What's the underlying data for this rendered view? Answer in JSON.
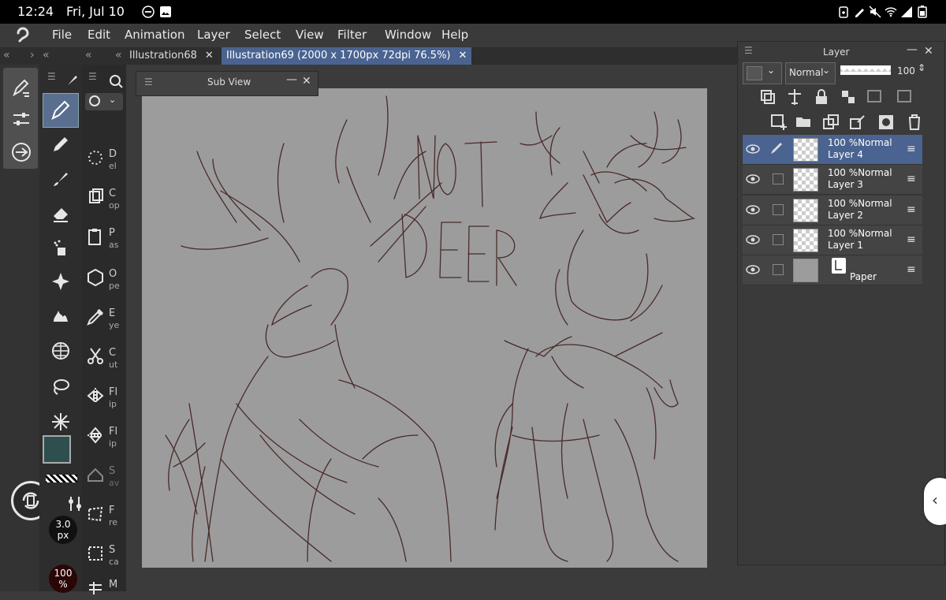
{
  "status_bar": {
    "time": "12:24",
    "date": "Fri, Jul 10"
  },
  "menu": [
    "File",
    "Edit",
    "Animation",
    "Layer",
    "Select",
    "View",
    "Filter",
    "Window",
    "Help"
  ],
  "tabs": [
    {
      "label": "Illustration68",
      "active": false
    },
    {
      "label": "Illustration69 (2000 x 1700px 72dpi 76.5%)",
      "active": true
    }
  ],
  "subview": {
    "title": "Sub View"
  },
  "subtools": [
    {
      "t1": "D",
      "t2": "el"
    },
    {
      "t1": "C",
      "t2": "op"
    },
    {
      "t1": "P",
      "t2": "as"
    },
    {
      "t1": "O",
      "t2": "pe"
    },
    {
      "t1": "E",
      "t2": "ye"
    },
    {
      "t1": "C",
      "t2": "ut"
    },
    {
      "t1": "Fl",
      "t2": "ip"
    },
    {
      "t1": "Fl",
      "t2": "ip"
    },
    {
      "t1": "S",
      "t2": "av"
    },
    {
      "t1": "F",
      "t2": "re"
    },
    {
      "t1": "S",
      "t2": "ca"
    },
    {
      "t1": "M",
      "t2": ""
    }
  ],
  "brush": {
    "size": "3.0",
    "size_unit": "px",
    "opacity": "100",
    "opacity_unit": "%"
  },
  "colors": {
    "main": "#2f4f4f",
    "sub": "#2a0a0a",
    "accent": "#4a6390",
    "canvas": "#9c9c9c",
    "sketch": "#4a2a2a"
  },
  "canvas_text": {
    "line1": "NOT",
    "line2": "DEER"
  },
  "layer_panel": {
    "title": "Layer",
    "blend_mode": "Normal",
    "opacity_value": "100",
    "layers": [
      {
        "opacity_mode": "100 %Normal",
        "name": "Layer 4",
        "selected": true
      },
      {
        "opacity_mode": "100 %Normal",
        "name": "Layer 3",
        "selected": false
      },
      {
        "opacity_mode": "100 %Normal",
        "name": "Layer 2",
        "selected": false
      },
      {
        "opacity_mode": "100 %Normal",
        "name": "Layer 1",
        "selected": false
      }
    ],
    "paper_layer": {
      "name": "Paper"
    }
  }
}
